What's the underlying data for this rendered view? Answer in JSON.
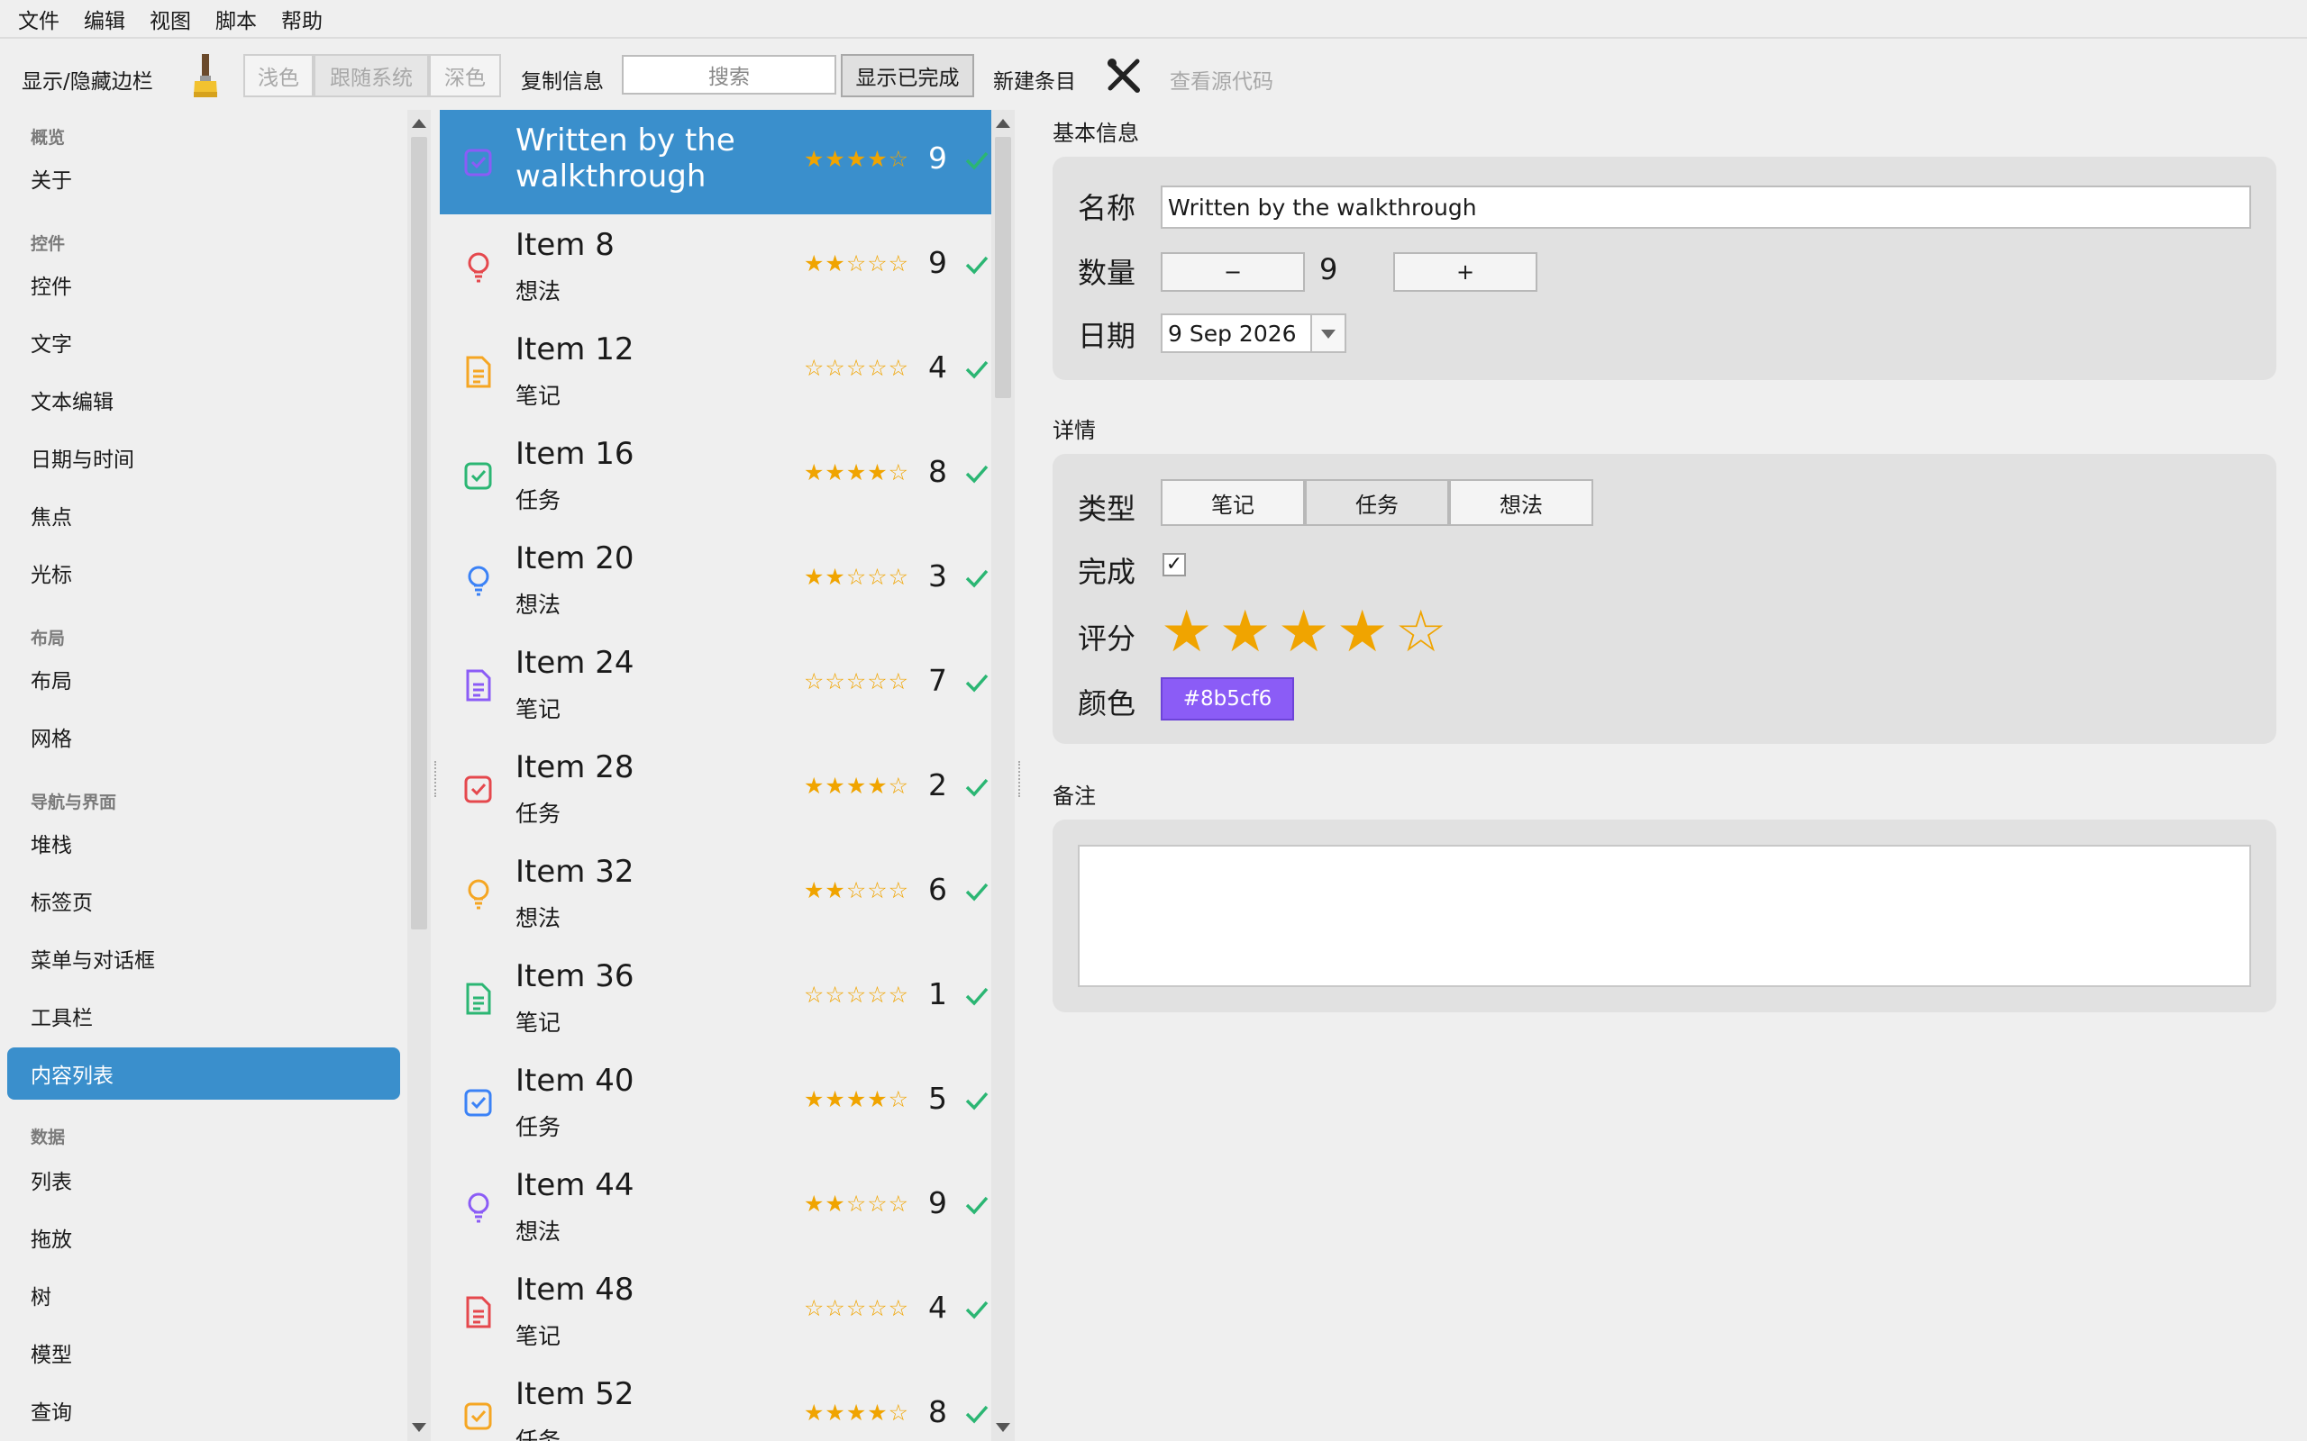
{
  "menu": [
    "文件",
    "编辑",
    "视图",
    "脚本",
    "帮助"
  ],
  "toolbar": {
    "toggle_sidebar": "显示/隐藏边栏",
    "theme_light": "浅色",
    "theme_system": "跟随系统",
    "theme_dark": "深色",
    "copy_info": "复制信息",
    "search_placeholder": "搜索",
    "show_completed": "显示已完成",
    "new_item": "新建条目",
    "view_source": "查看源代码"
  },
  "sidebar": {
    "sections": [
      "概览",
      "控件",
      "布局",
      "导航与界面",
      "数据"
    ],
    "items": [
      "关于",
      "控件",
      "文字",
      "文本编辑",
      "日期与时间",
      "焦点",
      "光标",
      "布局",
      "网格",
      "堆栈",
      "标签页",
      "菜单与对话框",
      "工具栏",
      "内容列表",
      "列表",
      "拖放",
      "树",
      "模型",
      "查询"
    ],
    "selected": "内容列表"
  },
  "list": {
    "items": [
      {
        "title": "Written by the walkthrough",
        "type": "",
        "rating": 4,
        "qty": "9",
        "icon": "task-icon",
        "color": "#8b5cf6"
      },
      {
        "title": "Item 8",
        "type": "想法",
        "rating": 2,
        "qty": "9",
        "icon": "idea-icon",
        "color": "#e5484d"
      },
      {
        "title": "Item 12",
        "type": "笔记",
        "rating": 0,
        "qty": "4",
        "icon": "note-icon",
        "color": "#f5a623"
      },
      {
        "title": "Item 16",
        "type": "任务",
        "rating": 4,
        "qty": "8",
        "icon": "task-icon",
        "color": "#2bb673"
      },
      {
        "title": "Item 20",
        "type": "想法",
        "rating": 2,
        "qty": "3",
        "icon": "idea-icon",
        "color": "#3b82f6"
      },
      {
        "title": "Item 24",
        "type": "笔记",
        "rating": 0,
        "qty": "7",
        "icon": "note-icon",
        "color": "#8b5cf6"
      },
      {
        "title": "Item 28",
        "type": "任务",
        "rating": 4,
        "qty": "2",
        "icon": "task-icon",
        "color": "#e5484d"
      },
      {
        "title": "Item 32",
        "type": "想法",
        "rating": 2,
        "qty": "6",
        "icon": "idea-icon",
        "color": "#f5a623"
      },
      {
        "title": "Item 36",
        "type": "笔记",
        "rating": 0,
        "qty": "1",
        "icon": "note-icon",
        "color": "#2bb673"
      },
      {
        "title": "Item 40",
        "type": "任务",
        "rating": 4,
        "qty": "5",
        "icon": "task-icon",
        "color": "#3b82f6"
      },
      {
        "title": "Item 44",
        "type": "想法",
        "rating": 2,
        "qty": "9",
        "icon": "idea-icon",
        "color": "#8b5cf6"
      },
      {
        "title": "Item 48",
        "type": "笔记",
        "rating": 0,
        "qty": "4",
        "icon": "note-icon",
        "color": "#e5484d"
      },
      {
        "title": "Item 52",
        "type": "任务",
        "rating": 4,
        "qty": "8",
        "icon": "task-icon",
        "color": "#f5a623"
      }
    ],
    "check_color": "#2bb673"
  },
  "detail": {
    "basic_title": "基本信息",
    "name_label": "名称",
    "name_value": "Written by the walkthrough",
    "qty_label": "数量",
    "qty_minus": "−",
    "qty_value": "9",
    "qty_plus": "+",
    "date_label": "日期",
    "date_value": "9 Sep 2026",
    "details_title": "详情",
    "type_label": "类型",
    "type_options": [
      "笔记",
      "任务",
      "想法"
    ],
    "type_selected": "任务",
    "done_label": "完成",
    "done_checked": true,
    "rating_label": "评分",
    "rating_value": 4,
    "rating_max": 5,
    "color_label": "颜色",
    "color_value": "#8b5cf6",
    "color_text": "#8b5cf6",
    "notes_title": "备注",
    "notes_value": ""
  }
}
